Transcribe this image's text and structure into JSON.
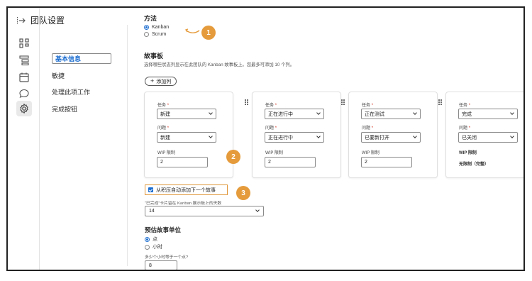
{
  "header": {
    "title": "团队设置"
  },
  "submenu": {
    "items": [
      "基本信息",
      "敏捷",
      "处理此项工作",
      "完成按钮"
    ]
  },
  "method": {
    "heading": "方法",
    "options": [
      "Kanban",
      "Scrum"
    ],
    "selected": "Kanban"
  },
  "board": {
    "heading": "故事板",
    "description": "选择哪些状态列显示在此团队的 Kanban 故事板上。您最多可添加 10 个列。",
    "add_button": "添加列",
    "task_label": "任务",
    "issue_label": "问题",
    "required_mark": "*",
    "wip_label": "WIP 限制",
    "columns": [
      {
        "task": "新建",
        "issue": "新建",
        "wip": "2"
      },
      {
        "task": "正在进行中",
        "issue": "正在进行中",
        "wip": "2"
      },
      {
        "task": "正在测试",
        "issue": "已要新打开",
        "wip": "2"
      },
      {
        "task": "完成",
        "issue": "已关闭",
        "wip_text": "无限制（完整）"
      }
    ]
  },
  "auto_add": {
    "label": "从积压自动添加下一个故事",
    "checked": true
  },
  "done_days": {
    "label": "“已完成”卡片留在 Kanban 展示板上的天数",
    "value": "14"
  },
  "estimate": {
    "heading": "预估故事单位",
    "options": [
      "点",
      "小时"
    ],
    "selected": "点",
    "hours_label": "多少个小时等于一个点?",
    "hours_value": "8"
  },
  "callouts": [
    "1",
    "2",
    "3"
  ],
  "colors": {
    "accent": "#1f6fd0",
    "callout": "#e59b3b",
    "required": "#d0311f"
  }
}
